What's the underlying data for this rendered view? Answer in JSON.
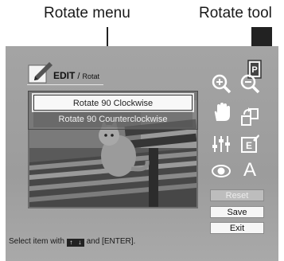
{
  "callouts": {
    "menu": "Rotate menu",
    "tool": "Rotate tool"
  },
  "header": {
    "title": "EDIT",
    "crumb": "Rotat"
  },
  "rotate_menu": {
    "items": [
      "Rotate  90  Clockwise",
      "Rotate  90  Counterclockwise"
    ],
    "selected_index": 0
  },
  "buttons": {
    "reset": "Reset",
    "save": "Save",
    "exit": "Exit"
  },
  "status": {
    "prefix": "Select item with",
    "suffix": "and [ENTER].",
    "up": "↑",
    "down": "↓"
  },
  "tools": [
    "zoom-in-icon",
    "zoom-out-icon",
    "hand-icon",
    "rotate-icon",
    "adjust-icon",
    "frame-text-icon",
    "red-eye-icon",
    "text-icon"
  ],
  "colors": {
    "background": "#a0a0a0",
    "icon": "#ffffff",
    "button": "#f6f6f6",
    "button_disabled": "#bdbdbd"
  }
}
